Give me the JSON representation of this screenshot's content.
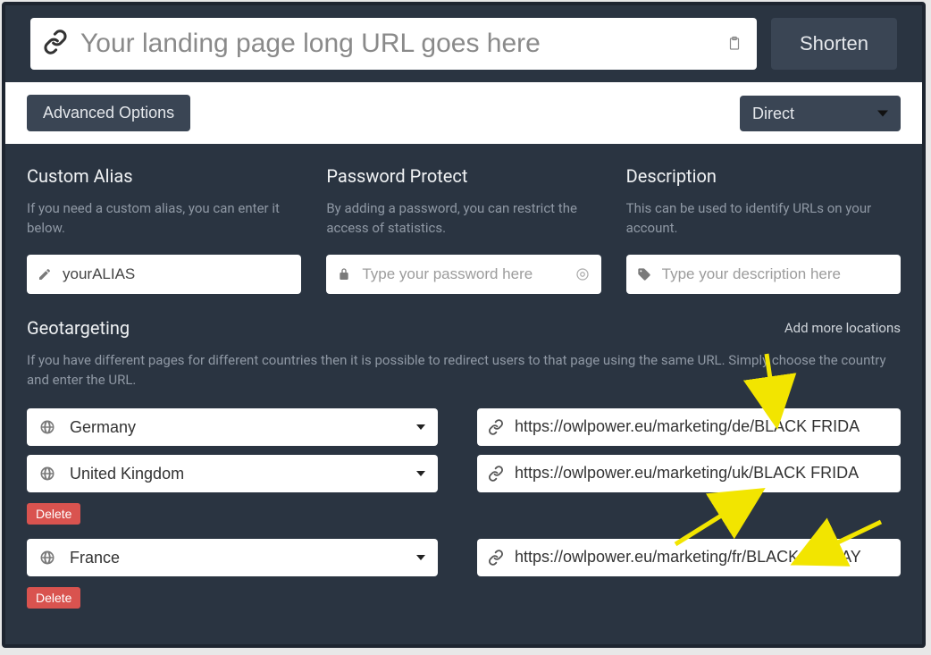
{
  "top": {
    "url_placeholder": "Your landing page long URL goes here",
    "shorten_label": "Shorten"
  },
  "options": {
    "advanced_label": "Advanced Options",
    "redirect_selected": "Direct"
  },
  "columns": {
    "alias": {
      "title": "Custom Alias",
      "desc": "If you need a custom alias, you can enter it below.",
      "value": "yourALIAS"
    },
    "password": {
      "title": "Password Protect",
      "desc": "By adding a password, you can restrict the access of statistics.",
      "placeholder": "Type your password here"
    },
    "description": {
      "title": "Description",
      "desc": "This can be used to identify URLs on your account.",
      "placeholder": "Type your description here"
    }
  },
  "geo": {
    "title": "Geotargeting",
    "add_more": "Add more locations",
    "desc": "If you have different pages for different countries then it is possible to redirect users to that page using the same URL. Simply choose the country and enter the URL.",
    "rows": [
      {
        "country": "Germany",
        "url": "https://owlpower.eu/marketing/de/BLACK FRIDA",
        "deletable": false
      },
      {
        "country": "United Kingdom",
        "url": "https://owlpower.eu/marketing/uk/BLACK FRIDA",
        "deletable": true
      },
      {
        "country": "France",
        "url": "https://owlpower.eu/marketing/fr/BLACK FRIDAY",
        "deletable": true
      }
    ],
    "delete_label": "Delete"
  }
}
